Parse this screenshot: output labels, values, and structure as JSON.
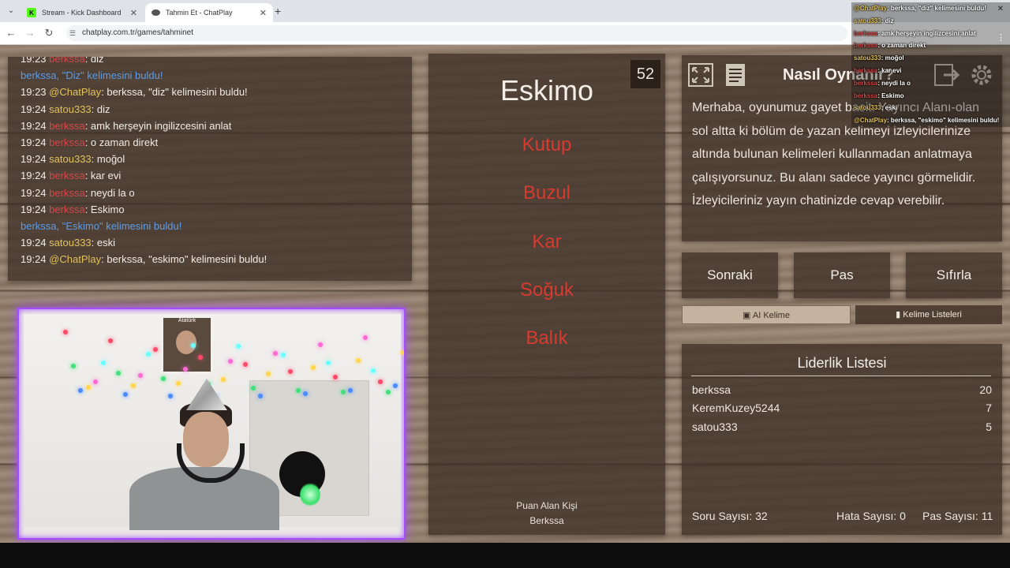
{
  "browser": {
    "tabs": [
      {
        "title": "Stream - Kick Dashboard",
        "icon": "K"
      },
      {
        "title": "Tahmin Et - ChatPlay",
        "icon": ""
      }
    ],
    "tab_close": "✕",
    "new_tab": "+",
    "url": "chatplay.com.tr/games/tahminet"
  },
  "chat": {
    "lines": [
      {
        "ts": "19:23",
        "user": "berkssa",
        "msg": ": diz",
        "color": "red"
      },
      {
        "ts": "",
        "user": "berkssa, \"Diz\" kelimesini buldu!",
        "msg": "",
        "color": "blue"
      },
      {
        "ts": "19:23",
        "user": "@ChatPlay",
        "msg": ": berkssa, \"diz\" kelimesini buldu!",
        "color": "yellow"
      },
      {
        "ts": "19:24",
        "user": "satou333",
        "msg": ": diz",
        "color": "yellow"
      },
      {
        "ts": "19:24",
        "user": "berkssa",
        "msg": ": amk herşeyin ingilizcesini anlat",
        "color": "red"
      },
      {
        "ts": "19:24",
        "user": "berkssa",
        "msg": ": o zaman direkt",
        "color": "red"
      },
      {
        "ts": "19:24",
        "user": "satou333",
        "msg": ": moğol",
        "color": "yellow"
      },
      {
        "ts": "19:24",
        "user": "berkssa",
        "msg": ": kar evi",
        "color": "red"
      },
      {
        "ts": "19:24",
        "user": "berkssa",
        "msg": ": neydi la o",
        "color": "red"
      },
      {
        "ts": "19:24",
        "user": "berkssa",
        "msg": ": Eskimo",
        "color": "red"
      },
      {
        "ts": "",
        "user": "berkssa, \"Eskimo\" kelimesini buldu!",
        "msg": "",
        "color": "blue"
      },
      {
        "ts": "19:24",
        "user": "satou333",
        "msg": ": eski",
        "color": "yellow"
      },
      {
        "ts": "19:24",
        "user": "@ChatPlay",
        "msg": ": berkssa, \"eskimo\" kelimesini buldu!",
        "color": "yellow"
      }
    ]
  },
  "camera": {
    "poster_text": "Atatürk"
  },
  "card": {
    "timer": "52",
    "word": "Eskimo",
    "forbidden": [
      "Kutup",
      "Buzul",
      "Kar",
      "Soğuk",
      "Balık"
    ],
    "scorer_caption": "Puan Alan Kişi",
    "scorer_name": "Berkssa"
  },
  "how": {
    "title": "Nasıl Oynanır?",
    "text": "Merhaba, oyunumuz gayet basit. Yayıncı Alanı-olan sol altta ki bölüm de yazan kelimeyi izleyicilerinize altında bulunan kelimeleri kullanmadan anlatmaya çalışıyorsunuz. Bu alanı sadece yayıncı görmelidir. İzleyicileriniz yayın chatinizde cevap verebilir."
  },
  "buttons": {
    "next": "Sonraki",
    "pass": "Pas",
    "reset": "Sıfırla",
    "ai_word": "AI Kelime",
    "word_lists": "Kelime Listeleri"
  },
  "leaderboard": {
    "title": "Liderlik Listesi",
    "rows": [
      {
        "name": "berkssa",
        "score": "20"
      },
      {
        "name": "KeremKuzey5244",
        "score": "7"
      },
      {
        "name": "satou333",
        "score": "5"
      }
    ],
    "question_count": "Soru Sayısı: 32",
    "error_count": "Hata Sayısı: 0",
    "pass_count": "Pas Sayısı: 11"
  },
  "overlay": {
    "lines": [
      {
        "user": "@ChatPlay",
        "msg": ": berkssa, \"diz\" kelimesini buldu!",
        "color": "#e2c25a"
      },
      {
        "user": "satou333",
        "msg": ": diz",
        "color": "#e2c25a"
      },
      {
        "user": "berkssa",
        "msg": ": amk herşeyin ingilizcesini anlat",
        "color": "#d34848"
      },
      {
        "user": "berkssa",
        "msg": ": o zaman direkt",
        "color": "#d34848"
      },
      {
        "user": "satou333",
        "msg": ": moğol",
        "color": "#e2c25a"
      },
      {
        "user": "berkssa",
        "msg": ": kar evi",
        "color": "#d34848"
      },
      {
        "user": "berkssa",
        "msg": ": neydi la o",
        "color": "#d34848"
      },
      {
        "user": "berkssa",
        "msg": ": Eskimo",
        "color": "#d34848"
      },
      {
        "user": "satou333",
        "msg": ": eski",
        "color": "#e2c25a"
      },
      {
        "user": "@ChatPlay",
        "msg": ": berkssa, \"eskimo\" kelimesini buldu!",
        "color": "#e2c25a"
      }
    ]
  },
  "colors": {
    "accent_purple": "#a44cff",
    "forbidden_red": "#d93a2f",
    "kick_green": "#53fc18"
  }
}
